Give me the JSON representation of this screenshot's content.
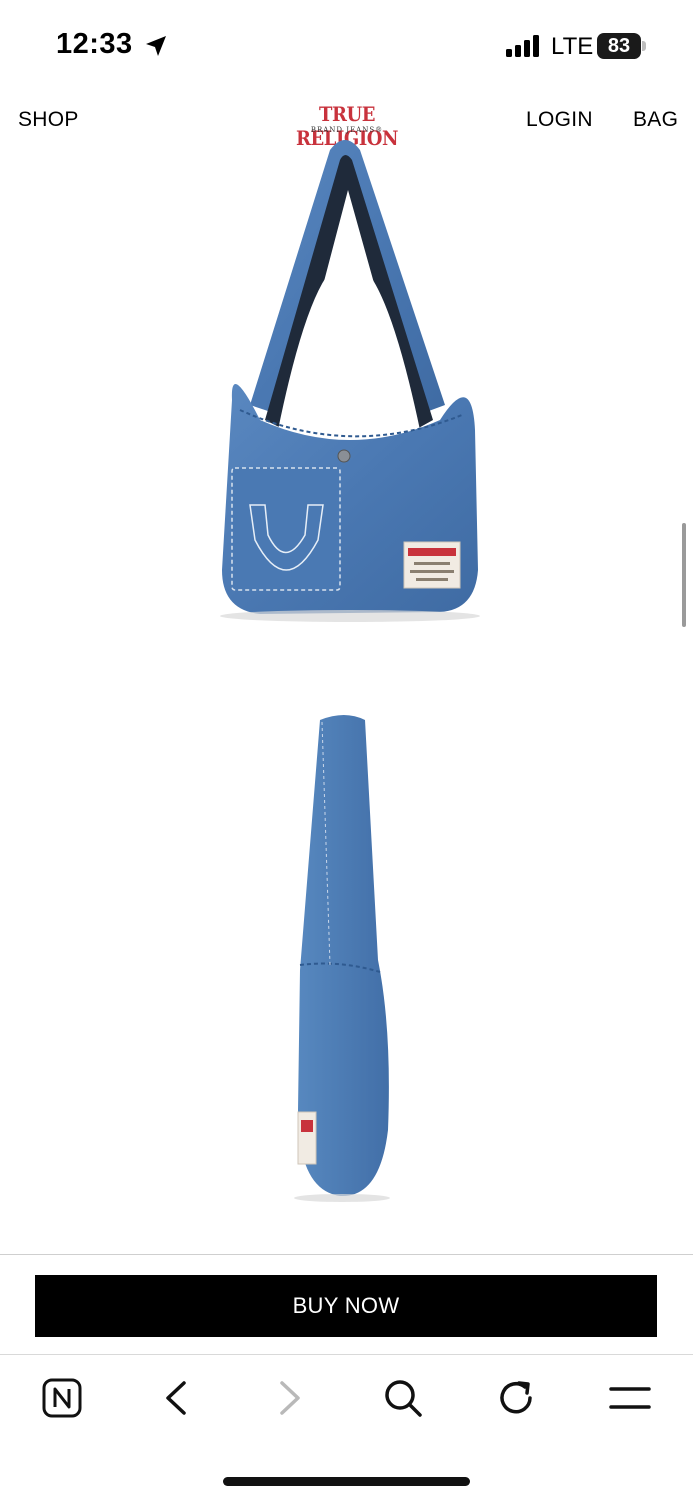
{
  "status_bar": {
    "time": "12:33",
    "network": "LTE",
    "battery": "83",
    "icons": [
      "location-arrow-icon",
      "cellular-signal-icon",
      "battery-icon"
    ]
  },
  "header": {
    "shop": "SHOP",
    "login": "LOGIN",
    "bag": "BAG",
    "logo_text": "TRUE RELIGION",
    "logo_subtext": "BRAND JEANS®"
  },
  "cta": {
    "buy_now": "BUY NOW"
  },
  "browser_toolbar": {
    "icons": [
      "tab-n-icon",
      "back-chevron-icon",
      "forward-chevron-icon",
      "search-icon",
      "reload-icon",
      "menu-icon"
    ]
  },
  "colors": {
    "denim": "#4a7ab5",
    "denim_dark": "#3c669c",
    "logo_red": "#c8323c",
    "button_bg": "#000000"
  }
}
